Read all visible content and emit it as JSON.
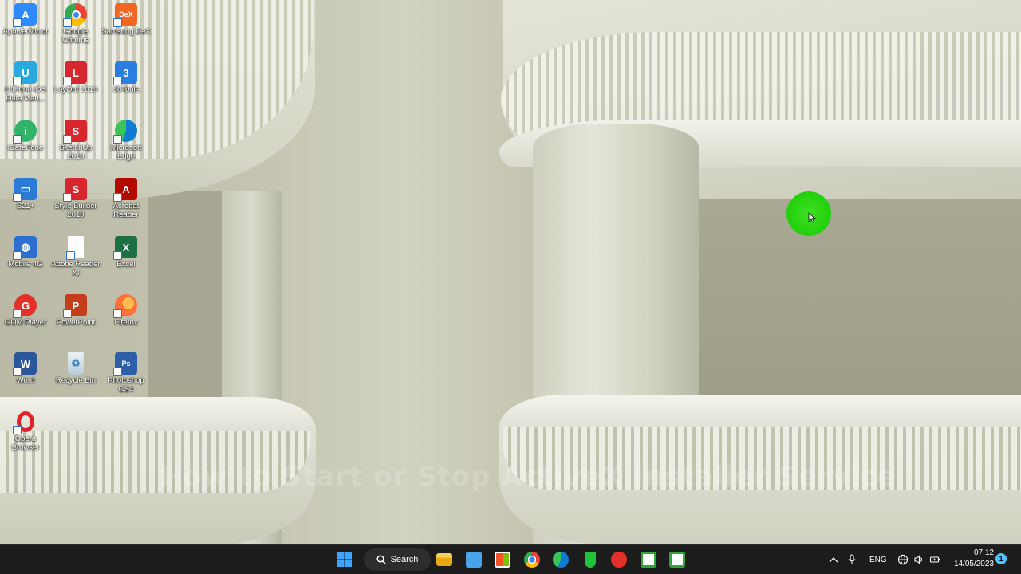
{
  "desktop": {
    "icons": [
      {
        "label": "ApowerMirror",
        "icon": "apowermirror-icon",
        "color": "#2e8bff"
      },
      {
        "label": "Google Chrome",
        "icon": "chrome-icon",
        "color": "#ea4335"
      },
      {
        "label": "Samsung DeX",
        "icon": "samsung-dex-icon",
        "color": "#f26522"
      },
      {
        "label": "UltFone iOS Data Man...",
        "icon": "ultfone-icon",
        "color": "#2aa9e0"
      },
      {
        "label": "LayOut 2019",
        "icon": "layout-icon",
        "color": "#d8262e"
      },
      {
        "label": "3uTools",
        "icon": "3utools-icon",
        "color": "#2a7de1"
      },
      {
        "label": "iCareFone",
        "icon": "icarefone-icon",
        "color": "#31b46a"
      },
      {
        "label": "SketchUp 2019",
        "icon": "sketchup-icon",
        "color": "#d8262e"
      },
      {
        "label": "Microsoft Edge",
        "icon": "edge-icon",
        "color": "#1e90c8"
      },
      {
        "label": "S21+",
        "icon": "s21-icon",
        "color": "#2b7bd6"
      },
      {
        "label": "Style Builder 2019",
        "icon": "style-builder-icon",
        "color": "#d8262e"
      },
      {
        "label": "Acrobat Reader",
        "icon": "acrobat-icon",
        "color": "#b30b00"
      },
      {
        "label": "Mobile 4G",
        "icon": "mobile-4g-icon",
        "color": "#2c6fd1"
      },
      {
        "label": "Adobe Reader XI",
        "icon": "adobe-reader-icon",
        "color": "#ffffff"
      },
      {
        "label": "Excel",
        "icon": "excel-icon",
        "color": "#1d7044"
      },
      {
        "label": "GOM Player",
        "icon": "gom-player-icon",
        "color": "#e5302a"
      },
      {
        "label": "PowerPoint",
        "icon": "powerpoint-icon",
        "color": "#c43e1c"
      },
      {
        "label": "Firefox",
        "icon": "firefox-icon",
        "color": "#ff7139"
      },
      {
        "label": "Word",
        "icon": "word-icon",
        "color": "#2b579a"
      },
      {
        "label": "Recycle Bin",
        "icon": "recycle-bin-icon",
        "color": "#d9e6ef"
      },
      {
        "label": "Photoshop CS4",
        "icon": "photoshop-icon",
        "color": "#2c5fa8"
      },
      {
        "label": "Opera Browser",
        "icon": "opera-icon",
        "color": "#e0202a"
      }
    ]
  },
  "watermark": "How to Start or Stop ActiveX Installer Service",
  "taskbar": {
    "search_label": "Search",
    "apps": [
      {
        "name": "file-explorer-icon",
        "color": "#f3c11b"
      },
      {
        "name": "notepad-icon",
        "color": "#4aa3e8"
      },
      {
        "name": "microsoft-store-icon",
        "color": "#ffffff"
      },
      {
        "name": "chrome-icon",
        "color": "#ea4335"
      },
      {
        "name": "edge-icon",
        "color": "#1e90c8"
      },
      {
        "name": "shield-icon",
        "color": "#21c13a"
      },
      {
        "name": "media-player-icon",
        "color": "#e5302a"
      },
      {
        "name": "camtasia-icon",
        "color": "#31a63b"
      },
      {
        "name": "camtasia-recorder-icon",
        "color": "#31a63b"
      }
    ],
    "tray": {
      "language": "ENG"
    },
    "clock": {
      "time": "07:12",
      "date": "14/05/2023"
    },
    "notification_count": "1"
  }
}
